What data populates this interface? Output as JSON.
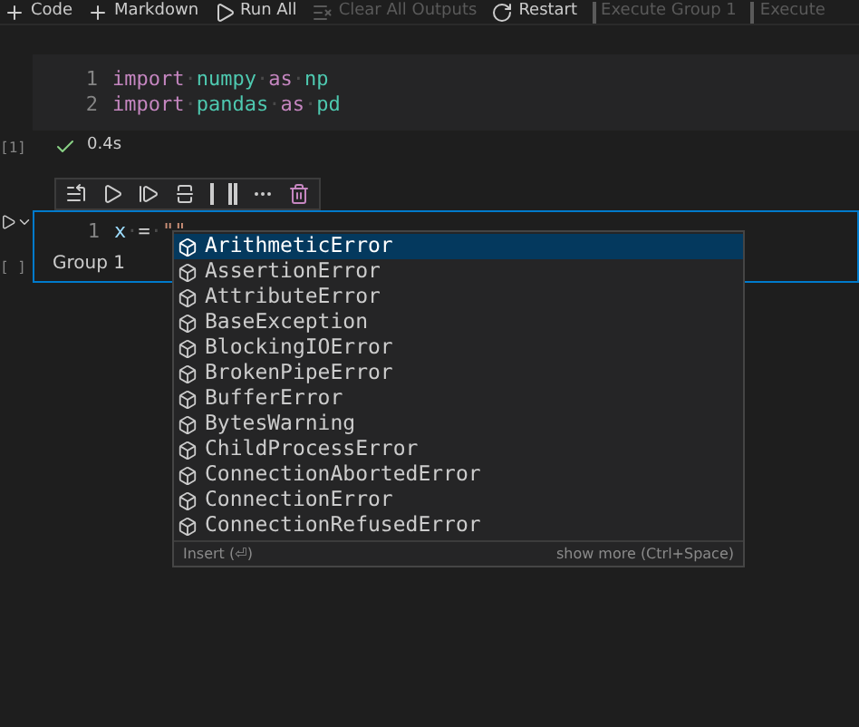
{
  "toolbar": [
    {
      "label": "Code",
      "kind": "plus",
      "disabled": false
    },
    {
      "label": "Markdown",
      "kind": "plus",
      "disabled": false
    },
    {
      "label": "Run All",
      "kind": "run",
      "disabled": false
    },
    {
      "label": "Clear All Outputs",
      "kind": "clear",
      "disabled": true
    },
    {
      "label": "Restart",
      "kind": "restart",
      "disabled": false
    },
    {
      "label": "Execute Group 1",
      "kind": "group",
      "disabled": true
    },
    {
      "label": "Execute",
      "kind": "group",
      "disabled": true
    }
  ],
  "cells": [
    {
      "execution_count": "[1]",
      "focused": false,
      "lines": [
        {
          "number": "1",
          "tokens": [
            {
              "text": "import",
              "kind": "keyword"
            },
            {
              "text": "·",
              "kind": "whitespace"
            },
            {
              "text": "numpy",
              "kind": "module"
            },
            {
              "text": "·",
              "kind": "whitespace"
            },
            {
              "text": "as",
              "kind": "keyword"
            },
            {
              "text": "·",
              "kind": "whitespace"
            },
            {
              "text": "np",
              "kind": "module"
            }
          ]
        },
        {
          "number": "2",
          "tokens": [
            {
              "text": "import",
              "kind": "keyword"
            },
            {
              "text": "·",
              "kind": "whitespace"
            },
            {
              "text": "pandas",
              "kind": "module"
            },
            {
              "text": "·",
              "kind": "whitespace"
            },
            {
              "text": "as",
              "kind": "keyword"
            },
            {
              "text": "·",
              "kind": "whitespace"
            },
            {
              "text": "pd",
              "kind": "module"
            }
          ]
        }
      ],
      "status": {
        "success": true,
        "duration": "0.4s"
      }
    },
    {
      "execution_count": "[ ]",
      "focused": true,
      "lines": [
        {
          "number": "1",
          "tokens": [
            {
              "text": "x",
              "kind": "variable"
            },
            {
              "text": "·",
              "kind": "whitespace"
            },
            {
              "text": "=",
              "kind": "operator"
            },
            {
              "text": "·",
              "kind": "whitespace"
            },
            {
              "text": "\"\"",
              "kind": "string"
            }
          ]
        }
      ],
      "group": "Group 1"
    }
  ],
  "suggestions": {
    "items": [
      {
        "label": "ArithmeticError",
        "selected": true
      },
      {
        "label": "AssertionError",
        "selected": false
      },
      {
        "label": "AttributeError",
        "selected": false
      },
      {
        "label": "BaseException",
        "selected": false
      },
      {
        "label": "BlockingIOError",
        "selected": false
      },
      {
        "label": "BrokenPipeError",
        "selected": false
      },
      {
        "label": "BufferError",
        "selected": false
      },
      {
        "label": "BytesWarning",
        "selected": false
      },
      {
        "label": "ChildProcessError",
        "selected": false
      },
      {
        "label": "ConnectionAbortedError",
        "selected": false
      },
      {
        "label": "ConnectionError",
        "selected": false
      },
      {
        "label": "ConnectionRefusedError",
        "selected": false
      }
    ],
    "footer_left": "Insert (⏎)",
    "footer_right": "show more (Ctrl+Space)"
  }
}
